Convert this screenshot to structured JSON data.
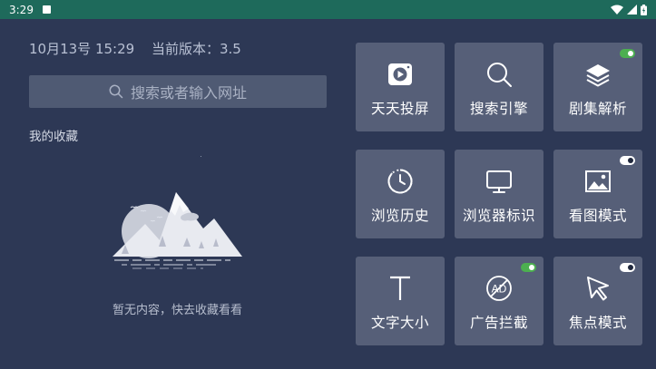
{
  "status_bar": {
    "time": "3:29",
    "icons": [
      "notification-square-icon",
      "wifi-icon",
      "signal-icon",
      "battery-icon"
    ]
  },
  "info": {
    "date_time": "10月13号 15:29",
    "version": "当前版本：3.5"
  },
  "search": {
    "placeholder": "搜索或者输入网址"
  },
  "favorites": {
    "title": "我的收藏",
    "empty_text": "暂无内容，快去收藏看看"
  },
  "tiles": [
    {
      "label": "天天投屏",
      "icon": "cast-play-icon"
    },
    {
      "label": "搜索引擎",
      "icon": "search-icon"
    },
    {
      "label": "剧集解析",
      "icon": "layers-icon",
      "toggle": "on"
    },
    {
      "label": "浏览历史",
      "icon": "history-clock-icon"
    },
    {
      "label": "浏览器标识",
      "icon": "monitor-icon"
    },
    {
      "label": "看图模式",
      "icon": "image-icon",
      "toggle": "off"
    },
    {
      "label": "文字大小",
      "icon": "text-size-icon"
    },
    {
      "label": "广告拦截",
      "icon": "ad-block-icon",
      "toggle": "on"
    },
    {
      "label": "焦点模式",
      "icon": "cursor-pointer-icon",
      "toggle": "off"
    }
  ],
  "colors": {
    "background": "#2d3855",
    "status_bar": "#1e6a5b",
    "tile": "#565f78",
    "toggle_on": "#4caf50"
  }
}
